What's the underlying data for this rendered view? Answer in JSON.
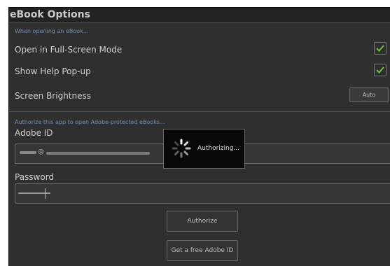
{
  "title": "eBook Options",
  "opening": {
    "section_label": "When opening an eBook...",
    "fullscreen_label": "Open in Full-Screen Mode",
    "fullscreen_checked": true,
    "help_label": "Show Help Pop-up",
    "help_checked": true,
    "brightness_label": "Screen Brightness",
    "brightness_button": "Auto"
  },
  "authorize": {
    "section_label": "Authorize this app to open Adobe-protected eBooks...",
    "adobe_id_label": "Adobe ID",
    "adobe_id_value": "@",
    "password_label": "Password",
    "authorize_button": "Authorize",
    "free_id_button": "Get a free Adobe ID"
  },
  "dialog": {
    "message": "Authorizing..."
  },
  "colors": {
    "check": "#6fc33a",
    "section_text": "#6f8fb3"
  }
}
